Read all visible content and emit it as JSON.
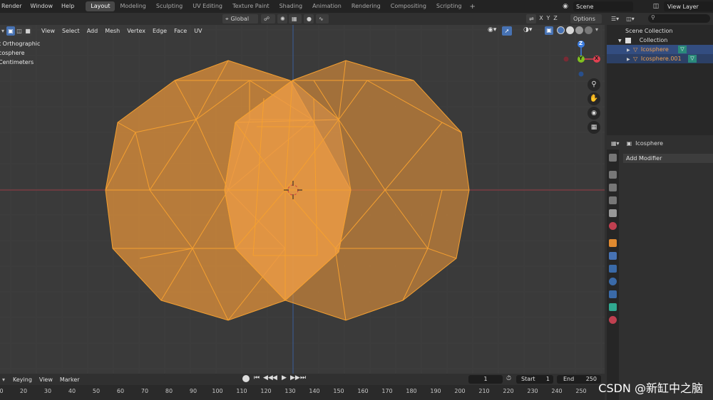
{
  "menu": {
    "items": [
      "Render",
      "Window",
      "Help"
    ]
  },
  "workspaces": {
    "tabs": [
      "Layout",
      "Modeling",
      "Sculpting",
      "UV Editing",
      "Texture Paint",
      "Shading",
      "Animation",
      "Rendering",
      "Compositing",
      "Scripting"
    ],
    "active": "Layout",
    "add_label": "+"
  },
  "scene": {
    "name": "Scene"
  },
  "view_layer": {
    "name": "View Layer"
  },
  "viewport_header": {
    "orientation": "Global",
    "options_label": "Options",
    "axis_x": "X",
    "axis_y": "Y",
    "axis_z": "Z",
    "menus": [
      "View",
      "Select",
      "Add",
      "Mesh",
      "Vertex",
      "Edge",
      "Face",
      "UV"
    ]
  },
  "viewport_info": {
    "line1": "t Orthographic",
    "line2": "cosphere",
    "line3": "Centimeters"
  },
  "gizmo": {
    "x": "X",
    "y": "Y",
    "z": "Z"
  },
  "outliner": {
    "root": "Scene Collection",
    "collection": "Collection",
    "objects": [
      "Icosphere",
      "Icosphere.001"
    ]
  },
  "properties": {
    "object_name": "Icosphere",
    "add_modifier": "Add Modifier"
  },
  "timeline": {
    "menus": [
      "Keying",
      "View",
      "Marker"
    ],
    "current_frame": "1",
    "start_label": "Start",
    "start_value": "1",
    "end_label": "End",
    "end_value": "250",
    "ticks": [
      "0",
      "20",
      "30",
      "40",
      "50",
      "60",
      "70",
      "80",
      "90",
      "100",
      "110",
      "120",
      "130",
      "140",
      "150",
      "160",
      "170",
      "180",
      "190",
      "200",
      "210",
      "220",
      "230",
      "240",
      "250"
    ]
  },
  "watermark": "CSDN @新缸中之脑",
  "colors": {
    "selection_orange": "#f5a030",
    "active_blue": "#4772b3",
    "axis_x": "#e04050",
    "axis_y": "#80c020",
    "axis_z": "#3c7de0"
  }
}
